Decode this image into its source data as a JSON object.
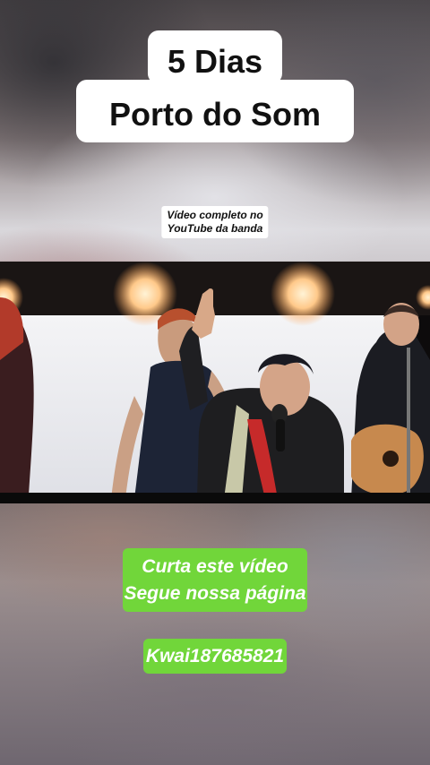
{
  "header": {
    "title_line1": "5 Dias",
    "title_line2": "Porto do Som"
  },
  "caption": {
    "line1": "Vídeo completo no",
    "line2": "YouTube da banda"
  },
  "video": {
    "icon": "video-frame"
  },
  "cta": {
    "line1": "Curta este vídeo",
    "line2": "Segue nossa página",
    "kwai_id": "Kwai187685821"
  },
  "colors": {
    "cta_green": "#71d63a",
    "title_bg": "#ffffff"
  }
}
